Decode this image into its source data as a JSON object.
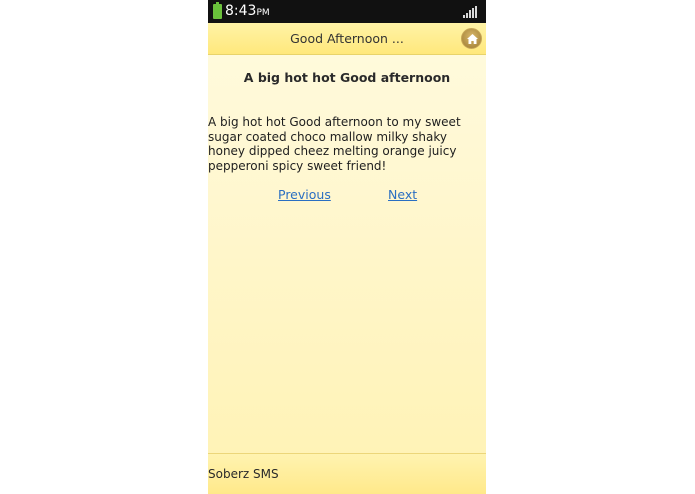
{
  "status_bar": {
    "time": "8:43",
    "ampm": "PM",
    "battery_icon": "battery-icon",
    "signal_icon": "signal-icon"
  },
  "header": {
    "title": "Good Afternoon ...",
    "home_icon": "home-icon"
  },
  "content": {
    "title": "A big hot hot Good afternoon",
    "message": "A big hot hot Good afternoon to my sweet sugar coated choco mallow milky shaky honey dipped cheez melting orange juicy pepperoni spicy sweet friend!",
    "previous_label": "Previous",
    "next_label": "Next"
  },
  "footer": {
    "text": "Soberz SMS"
  },
  "colors": {
    "header_bg": "#ffe87c",
    "page_bg": "#fff7cf",
    "link": "#2a6fc2",
    "status_bar_bg": "#111111"
  }
}
